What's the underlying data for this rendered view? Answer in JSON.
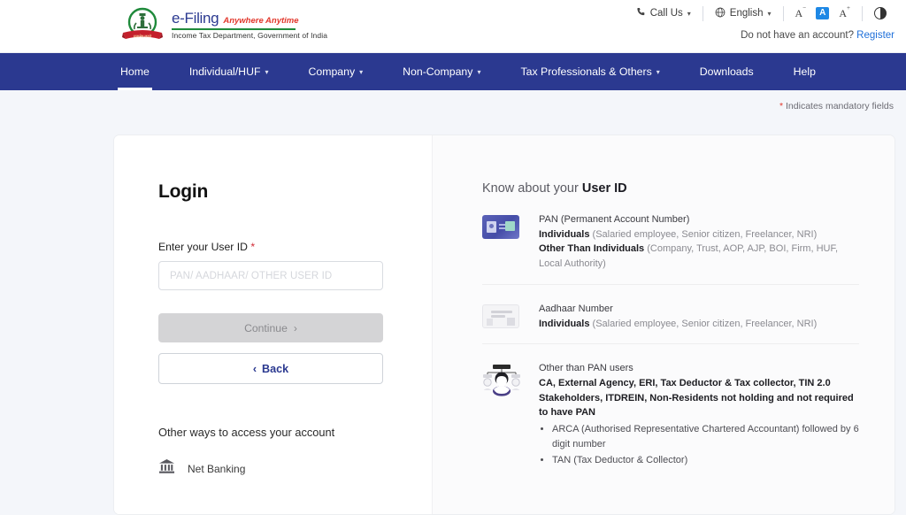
{
  "header": {
    "logo": {
      "emblem_alt": "india-emblem",
      "title": "e-Filing",
      "tagline": "Anywhere Anytime",
      "subtitle": "Income Tax Department, Government of India"
    },
    "call_us": "Call Us",
    "language": "English",
    "text_size": {
      "decrease": "A",
      "normal": "A",
      "increase": "A"
    },
    "contrast_icon": "contrast-icon",
    "account_prompt": "Do not have an account?",
    "register": "Register"
  },
  "nav": {
    "items": [
      {
        "label": "Home",
        "has_caret": false,
        "active": true
      },
      {
        "label": "Individual/HUF",
        "has_caret": true,
        "active": false
      },
      {
        "label": "Company",
        "has_caret": true,
        "active": false
      },
      {
        "label": "Non-Company",
        "has_caret": true,
        "active": false
      },
      {
        "label": "Tax Professionals & Others",
        "has_caret": true,
        "active": false
      },
      {
        "label": "Downloads",
        "has_caret": false,
        "active": false
      },
      {
        "label": "Help",
        "has_caret": false,
        "active": false
      }
    ]
  },
  "mandatory_note": {
    "star": "*",
    "text": "Indicates mandatory fields"
  },
  "login": {
    "title": "Login",
    "field_label": "Enter your User ID",
    "required_star": "*",
    "input_value": "",
    "input_placeholder": "PAN/ AADHAAR/ OTHER USER ID",
    "continue_label": "Continue",
    "continue_chevron": "›",
    "back_chevron": "‹",
    "back_label": "Back",
    "other_ways_title": "Other ways to access your account",
    "net_banking": "Net Banking"
  },
  "know": {
    "title_light": "Know about your",
    "title_bold": "User ID",
    "entries": [
      {
        "icon": "pan-card-icon",
        "heading": "PAN (Permanent Account Number)",
        "lines": [
          {
            "bold": "Individuals",
            "rest": " (Salaried employee, Senior citizen, Freelancer, NRI)"
          },
          {
            "bold": "Other Than Individuals",
            "rest": " (Company, Trust, AOP, AJP, BOI, Firm, HUF, Local Authority)"
          }
        ],
        "bullets": []
      },
      {
        "icon": "aadhaar-card-icon",
        "heading": "Aadhaar Number",
        "lines": [
          {
            "bold": "Individuals",
            "rest": " (Salaried employee, Senior citizen, Freelancer, NRI)"
          }
        ],
        "bullets": []
      },
      {
        "icon": "org-people-icon",
        "heading": "Other than PAN users",
        "lines": [
          {
            "bold": "CA, External Agency, ERI, Tax Deductor & Tax collector, TIN 2.0 Stakeholders, ITDREIN, Non-Residents not holding and not required to have PAN",
            "rest": ""
          }
        ],
        "bullets": [
          "ARCA (Authorised Representative Chartered Accountant) followed by 6 digit number",
          "TAN (Tax Deductor & Collector)"
        ]
      }
    ]
  },
  "colors": {
    "nav_blue": "#2b3990",
    "brand_red": "#e2372b",
    "brand_green": "#1f8a3b",
    "link_blue": "#1e6fd9",
    "required_red": "#d12b36",
    "page_bg": "#f4f6fa"
  }
}
